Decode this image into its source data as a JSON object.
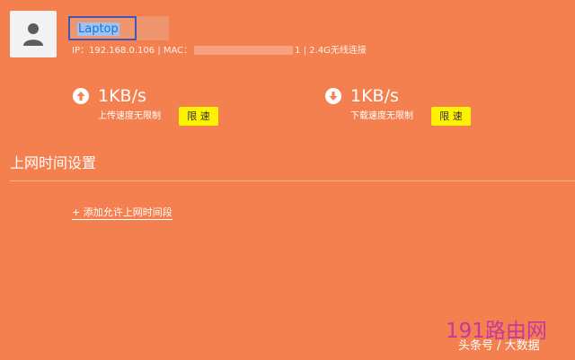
{
  "device": {
    "name": "Laptop",
    "ip_label": "IP：",
    "ip": "192.168.0.106",
    "separator": " | ",
    "mac_label": "MAC：",
    "mac_tail": "1",
    "connection": "2.4G无线连接"
  },
  "upload": {
    "icon": "arrow-up-circle-icon",
    "speed": "1KB/s",
    "label": "上传速度无限制",
    "button": "限 速"
  },
  "download": {
    "icon": "arrow-down-circle-icon",
    "speed": "1KB/s",
    "label": "下载速度无限制",
    "button": "限 速"
  },
  "schedule": {
    "title": "上网时间设置",
    "add_link": "+ 添加允许上网时间段"
  },
  "watermark": {
    "site": "191路由网",
    "source": "头条号 / 大数据"
  },
  "colors": {
    "background": "#f47f4f",
    "button": "#fff200",
    "highlight_border": "#4256b9",
    "watermark": "#c23aa0"
  }
}
